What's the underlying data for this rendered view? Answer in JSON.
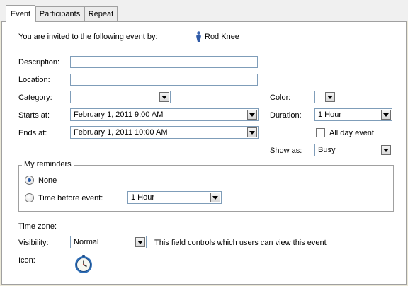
{
  "tabs": [
    {
      "label": "Event"
    },
    {
      "label": "Participants"
    },
    {
      "label": "Repeat"
    }
  ],
  "invite": {
    "text": "You are invited to the following event by:",
    "organizer": "Rod Knee"
  },
  "labels": {
    "description": "Description:",
    "location": "Location:",
    "category": "Category:",
    "starts_at": "Starts at:",
    "ends_at": "Ends at:",
    "color": "Color:",
    "duration": "Duration:",
    "all_day": "All day event",
    "show_as": "Show as:",
    "time_zone": "Time zone:",
    "visibility": "Visibility:",
    "icon": "Icon:"
  },
  "fields": {
    "description": "",
    "location": "",
    "category": "",
    "color": "",
    "starts_at": "February 1, 2011 9:00 AM",
    "ends_at": "February 1, 2011 10:00 AM",
    "duration": "1 Hour",
    "show_as": "Busy",
    "visibility": "Normal",
    "all_day": false
  },
  "reminders": {
    "title": "My reminders",
    "none_label": "None",
    "time_before_label": "Time before event:",
    "time_before_value": "1 Hour",
    "selected": "none"
  },
  "visibility_note": "This field controls which users can view this event",
  "icons": {
    "organizer": "user-icon",
    "event_icon": "clock-icon"
  },
  "colors": {
    "accent": "#2a5aa8",
    "border": "#7f9db9"
  }
}
